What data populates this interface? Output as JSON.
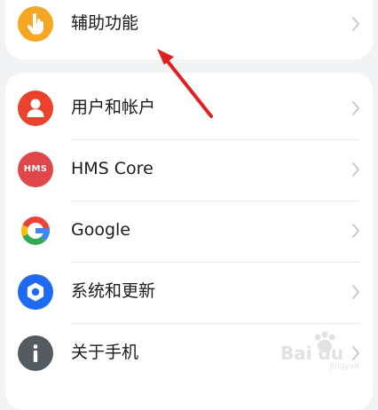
{
  "groups": [
    {
      "items": [
        {
          "label": "辅助功能",
          "icon": "accessibility-hand-icon",
          "icon_color": "#f5a623"
        }
      ]
    },
    {
      "items": [
        {
          "label": "用户和帐户",
          "icon": "user-account-icon",
          "icon_color": "#e9422e"
        },
        {
          "label": "HMS Core",
          "icon": "hms-core-icon",
          "icon_color": "#e0474b",
          "icon_text": "HMS"
        },
        {
          "label": "Google",
          "icon": "google-logo-icon",
          "icon_color": "#ffffff"
        },
        {
          "label": "系统和更新",
          "icon": "system-gear-icon",
          "icon_color": "#1f6af0"
        },
        {
          "label": "关于手机",
          "icon": "info-icon",
          "icon_color": "#555a60"
        }
      ]
    }
  ],
  "watermark": {
    "text": "Bai du",
    "sub": "jingyan"
  },
  "colors": {
    "background": "#f1f3f5",
    "card": "#ffffff",
    "chevron": "#c4c7cc",
    "annotation_arrow": "#e02020"
  }
}
